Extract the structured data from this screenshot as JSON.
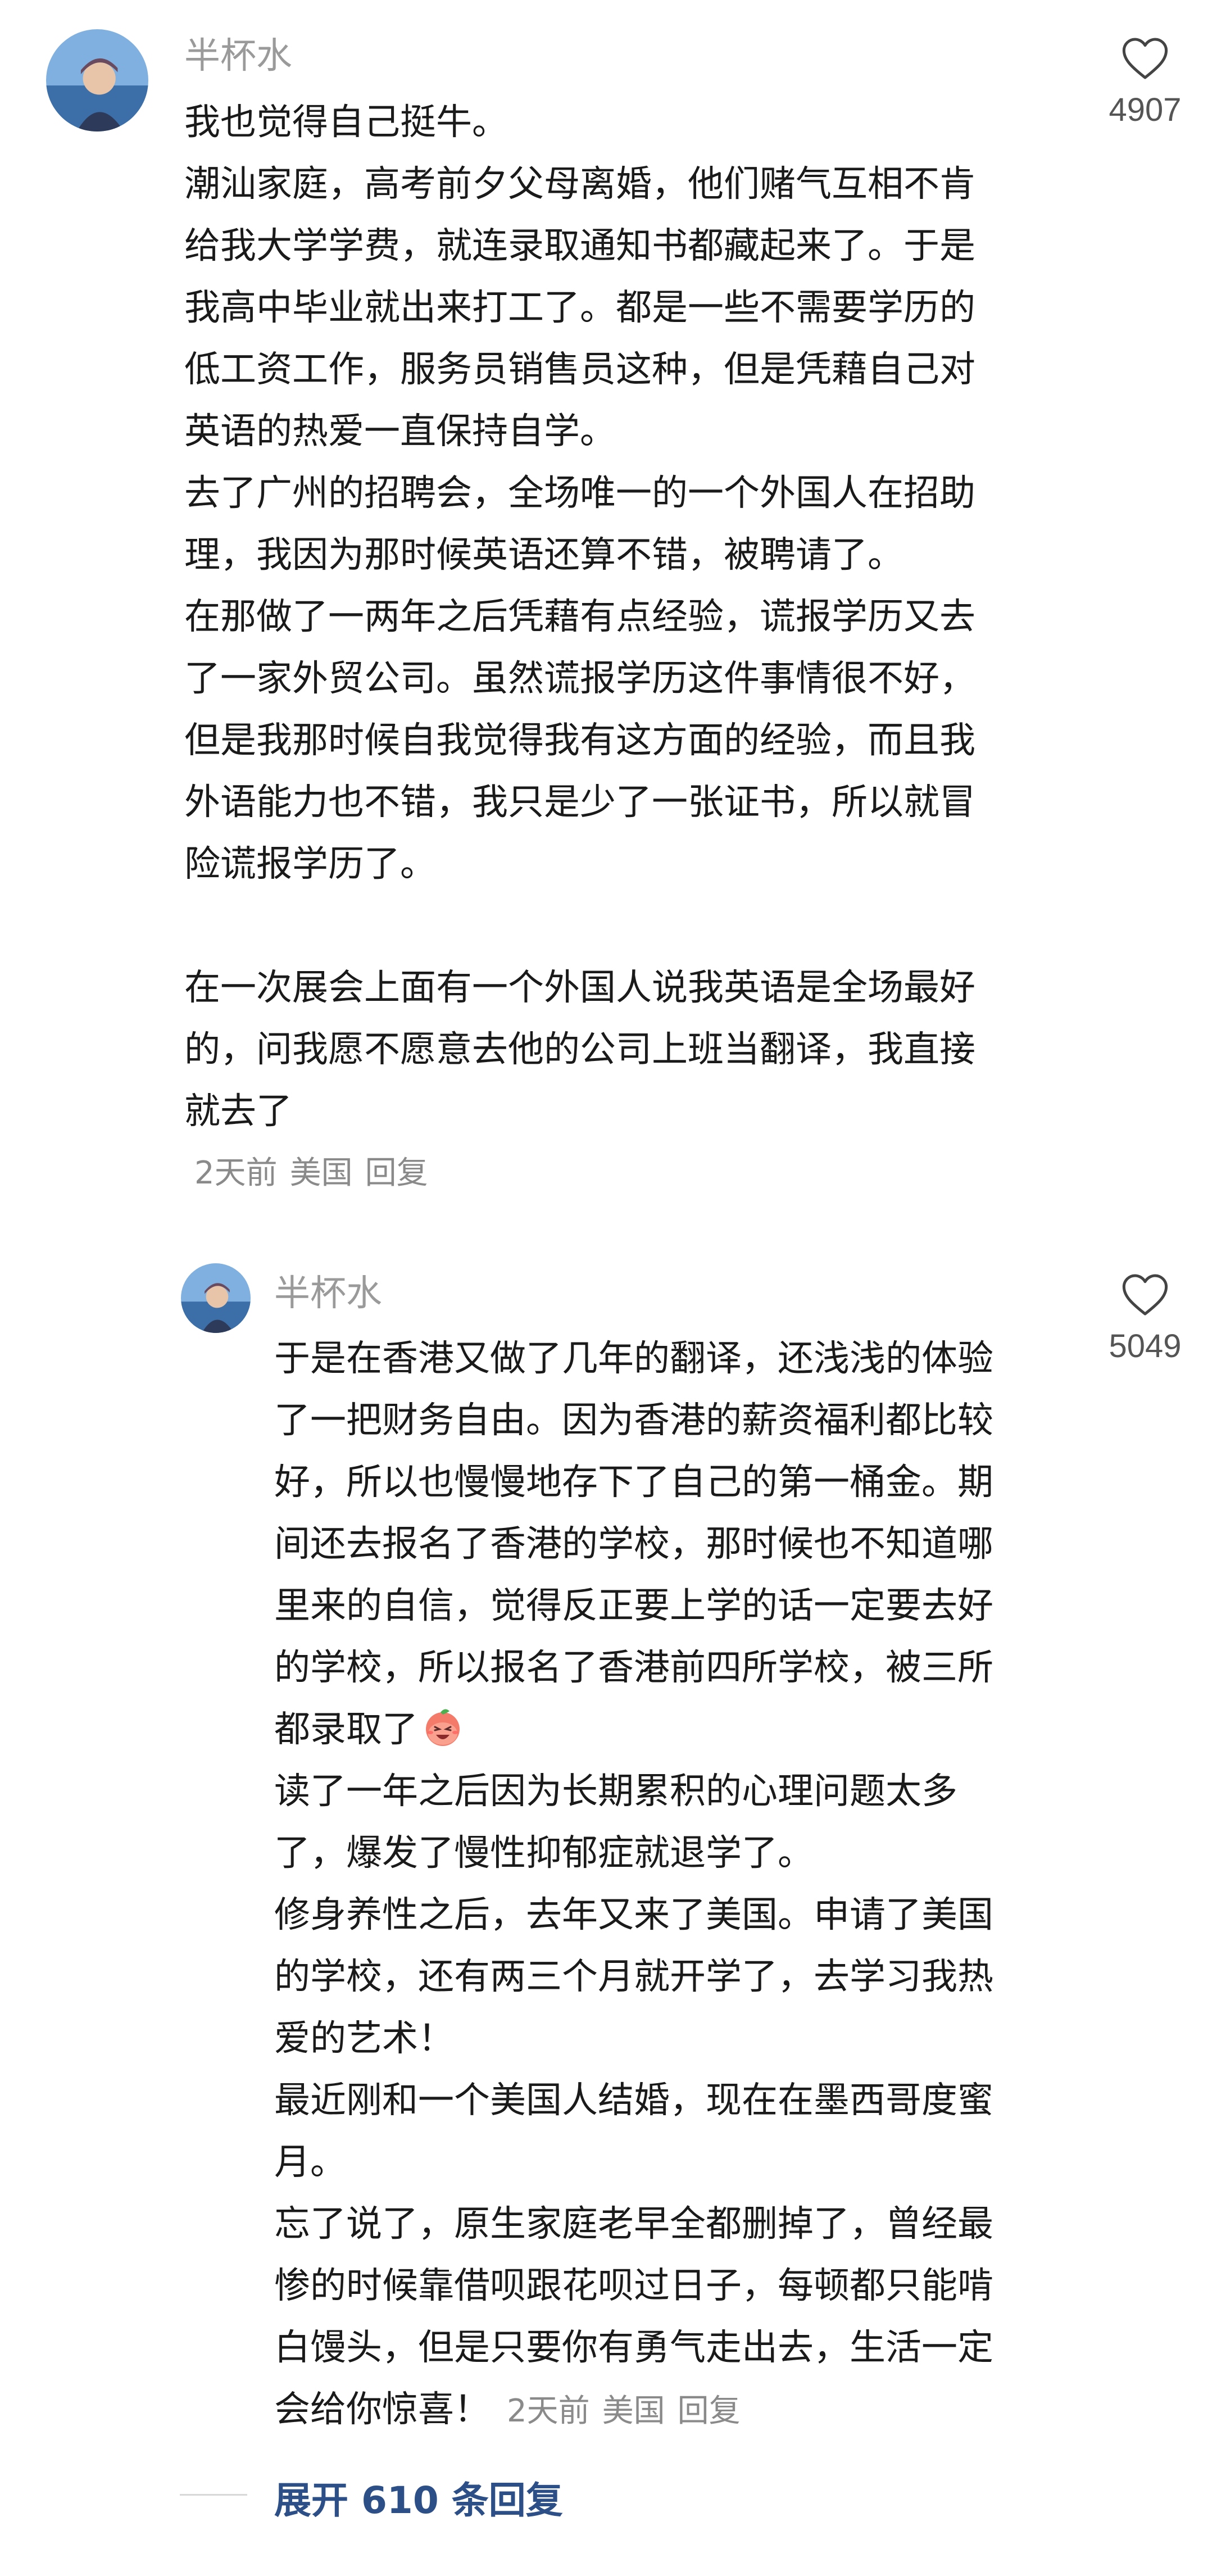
{
  "comment1": {
    "username": "半杯水",
    "like_count": "4907",
    "lines": [
      "我也觉得自己挺牛。",
      "潮汕家庭，高考前夕父母离婚，他们赌气互相不肯",
      "给我大学学费，就连录取通知书都藏起来了。于是",
      "我高中毕业就出来打工了。都是一些不需要学历的",
      "低工资工作，服务员销售员这种，但是凭藉自己对",
      "英语的热爱一直保持自学。",
      "去了广州的招聘会，全场唯一的一个外国人在招助",
      "理，我因为那时候英语还算不错，被聘请了。",
      "在那做了一两年之后凭藉有点经验，谎报学历又去",
      "了一家外贸公司。虽然谎报学历这件事情很不好，",
      "但是我那时候自我觉得我有这方面的经验，而且我",
      "外语能力也不错，我只是少了一张证书，所以就冒",
      "险谎报学历了。"
    ],
    "lines2": [
      "在一次展会上面有一个外国人说我英语是全场最好",
      "的，问我愿不愿意去他的公司上班当翻译，我直接",
      "就去了"
    ],
    "time": "2天前",
    "location": "美国",
    "reply_label": "回复"
  },
  "comment2": {
    "username": "半杯水",
    "like_count": "5049",
    "lines": [
      "于是在香港又做了几年的翻译，还浅浅的体验",
      "了一把财务自由。因为香港的薪资福利都比较",
      "好，所以也慢慢地存下了自己的第一桶金。期",
      "间还去报名了香港的学校，那时候也不知道哪",
      "里来的自信，觉得反正要上学的话一定要去好",
      "的学校，所以报名了香港前四所学校，被三所"
    ],
    "emoji_line": "都录取了",
    "emoji_name": "laughing-peach-emoji",
    "lines2": [
      "读了一年之后因为长期累积的心理问题太多",
      "了，爆发了慢性抑郁症就退学了。",
      "修身养性之后，去年又来了美国。申请了美国",
      "的学校，还有两三个月就开学了，去学习我热",
      "爱的艺术！",
      "最近刚和一个美国人结婚，现在在墨西哥度蜜",
      "月。",
      "忘了说了，原生家庭老早全都删掉了，曾经最",
      "惨的时候靠借呗跟花呗过日子，每顿都只能啃",
      "白馒头，但是只要你有勇气走出去，生活一定"
    ],
    "last_line": "会给你惊喜！",
    "time": "2天前",
    "location": "美国",
    "reply_label": "回复"
  },
  "expand": {
    "label": "展开 610 条回复"
  },
  "colors": {
    "text": "#1a1a1a",
    "username": "#9a9a9a",
    "meta": "#8a8a8a",
    "expand_link": "#2c4f87"
  }
}
